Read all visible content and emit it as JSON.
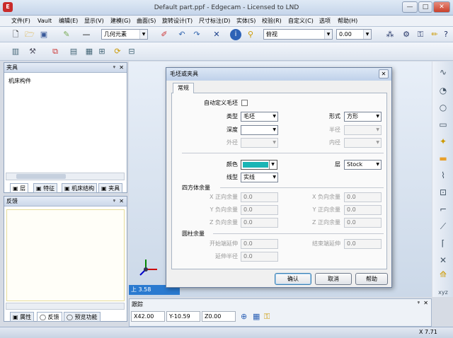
{
  "window": {
    "title": "Default part.ppf - Edgecam - Licensed to LND",
    "min": "—",
    "max": "□",
    "close": "✕"
  },
  "menu": [
    "文件(F)",
    "Vault",
    "编辑(E)",
    "显示(V)",
    "建模(G)",
    "曲面(S)",
    "旋转设计(T)",
    "尺寸标注(D)",
    "实体(S)",
    "校验(R)",
    "自定义(C)",
    "选项",
    "帮助(H)"
  ],
  "toolbar": {
    "geometry_combo": "几何元素",
    "view_combo": "俯视",
    "value_combo": "0.00"
  },
  "panel_top": {
    "title": "夹具",
    "item": "机床构件",
    "tabs": [
      "层",
      "特征",
      "机床结构",
      "夹具"
    ]
  },
  "panel_bottom": {
    "title": "反馈",
    "tabs": [
      "属性",
      "反馈",
      "预览功能"
    ]
  },
  "viewport": {
    "status": "上 3.58"
  },
  "dialog": {
    "title": "毛坯或夹具",
    "tab": "常规",
    "custom_blank_label": "自动定义毛坯",
    "type_label": "类型",
    "type_value": "毛坯",
    "form_label": "形式",
    "form_value": "方形",
    "depth_label": "深度",
    "radius_label": "半径",
    "outer_label": "外径",
    "inner_label": "内径",
    "color_label": "颜色",
    "color_value": "#1ab5b5",
    "layer_label": "层",
    "layer_value": "Stock",
    "linetype_label": "线型",
    "linetype_value": "实线",
    "box_section": "四方体余量",
    "box_fields": [
      {
        "label": "X 正向余量",
        "value": "0.0"
      },
      {
        "label": "X 负向余量",
        "value": "0.0"
      },
      {
        "label": "Y 负向余量",
        "value": "0.0"
      },
      {
        "label": "Y 正向余量",
        "value": "0.0"
      },
      {
        "label": "Z 负向余量",
        "value": "0.0"
      },
      {
        "label": "Z 正向余量",
        "value": "0.0"
      }
    ],
    "cyl_section": "圆柱余量",
    "start_ext_label": "开始端延伸",
    "start_ext_value": "0.0",
    "end_ext_label": "结束端延伸",
    "end_ext_value": "0.0",
    "ext_radius_label": "延伸半径",
    "ext_radius_value": "0.0",
    "ok": "确认",
    "cancel": "取消",
    "help": "帮助"
  },
  "tracking": {
    "title": "跟踪",
    "x": "X42.00",
    "y": "Y-10.59",
    "z": "Z0.00"
  },
  "status": {
    "right": "X 7.71"
  }
}
